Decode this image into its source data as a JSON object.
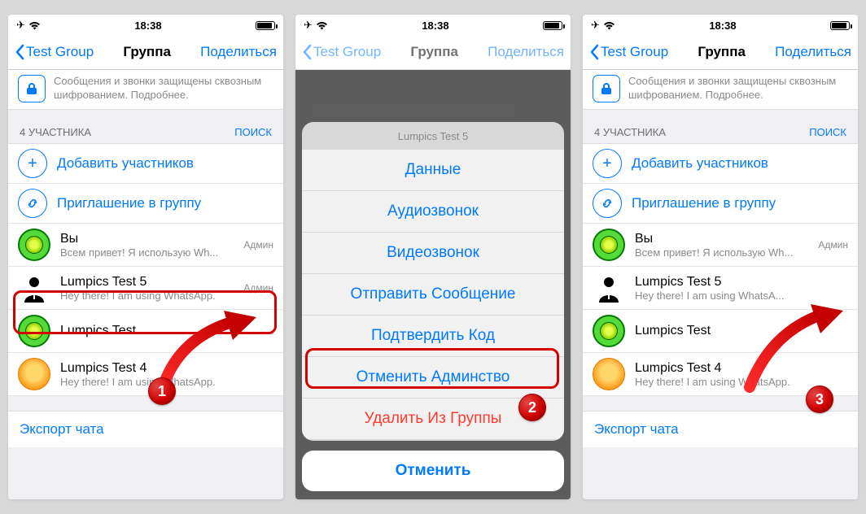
{
  "statusbar": {
    "time": "18:38"
  },
  "nav": {
    "back": "Test Group",
    "title": "Группа",
    "share": "Поделиться"
  },
  "encryption": "Сообщения и звонки защищены сквозным шифрованием. Подробнее.",
  "section": {
    "count_label": "4 УЧАСТНИКА",
    "search": "ПОИСК"
  },
  "actions": {
    "add": "Добавить участников",
    "invite": "Приглашение в группу"
  },
  "members_left": [
    {
      "name": "Вы",
      "status": "Всем привет! Я использую Wh...",
      "badge": "Админ"
    },
    {
      "name": "Lumpics Test 5",
      "status": "Hey there! I am using WhatsApp.",
      "badge": "Админ"
    },
    {
      "name": "Lumpics Test",
      "status": ""
    },
    {
      "name": "Lumpics Test 4",
      "status": "Hey there! I am using WhatsApp."
    }
  ],
  "members_right": [
    {
      "name": "Вы",
      "status": "Всем привет! Я использую Wh...",
      "badge": "Админ"
    },
    {
      "name": "Lumpics Test 5",
      "status": "Hey there! I am using WhatsA..."
    },
    {
      "name": "Lumpics Test",
      "status": ""
    },
    {
      "name": "Lumpics Test 4",
      "status": "Hey there! I am using WhatsApp."
    }
  ],
  "export": "Экспорт чата",
  "sheet": {
    "title": "Lumpics Test 5",
    "items": [
      "Данные",
      "Аудиозвонок",
      "Видеозвонок",
      "Отправить Сообщение",
      "Подтвердить Код",
      "Отменить Админство"
    ],
    "remove": "Удалить Из Группы",
    "cancel": "Отменить"
  },
  "steps": {
    "one": "1",
    "two": "2",
    "three": "3"
  }
}
